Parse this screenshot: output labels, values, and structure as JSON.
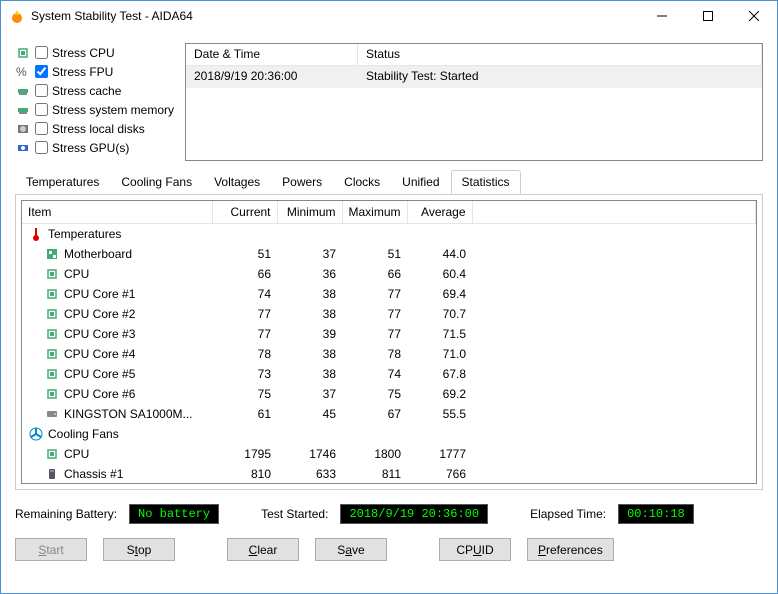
{
  "window": {
    "title": "System Stability Test - AIDA64"
  },
  "stress_options": [
    {
      "label": "Stress CPU",
      "checked": false
    },
    {
      "label": "Stress FPU",
      "checked": true
    },
    {
      "label": "Stress cache",
      "checked": false
    },
    {
      "label": "Stress system memory",
      "checked": false
    },
    {
      "label": "Stress local disks",
      "checked": false
    },
    {
      "label": "Stress GPU(s)",
      "checked": false
    }
  ],
  "log": {
    "headers": {
      "datetime": "Date & Time",
      "status": "Status"
    },
    "rows": [
      {
        "datetime": "2018/9/19 20:36:00",
        "status": "Stability Test: Started"
      }
    ]
  },
  "tabs": [
    "Temperatures",
    "Cooling Fans",
    "Voltages",
    "Powers",
    "Clocks",
    "Unified",
    "Statistics"
  ],
  "active_tab": "Statistics",
  "stats": {
    "headers": {
      "item": "Item",
      "current": "Current",
      "minimum": "Minimum",
      "maximum": "Maximum",
      "average": "Average"
    },
    "groups": [
      {
        "name": "Temperatures",
        "icon": "thermometer",
        "items": [
          {
            "name": "Motherboard",
            "icon": "mobo",
            "current": 51,
            "minimum": 37,
            "maximum": 51,
            "average": "44.0"
          },
          {
            "name": "CPU",
            "icon": "chip",
            "current": 66,
            "minimum": 36,
            "maximum": 66,
            "average": "60.4"
          },
          {
            "name": "CPU Core #1",
            "icon": "chip",
            "current": 74,
            "minimum": 38,
            "maximum": 77,
            "average": "69.4"
          },
          {
            "name": "CPU Core #2",
            "icon": "chip",
            "current": 77,
            "minimum": 38,
            "maximum": 77,
            "average": "70.7"
          },
          {
            "name": "CPU Core #3",
            "icon": "chip",
            "current": 77,
            "minimum": 39,
            "maximum": 77,
            "average": "71.5"
          },
          {
            "name": "CPU Core #4",
            "icon": "chip",
            "current": 78,
            "minimum": 38,
            "maximum": 78,
            "average": "71.0"
          },
          {
            "name": "CPU Core #5",
            "icon": "chip",
            "current": 73,
            "minimum": 38,
            "maximum": 74,
            "average": "67.8"
          },
          {
            "name": "CPU Core #6",
            "icon": "chip",
            "current": 75,
            "minimum": 37,
            "maximum": 75,
            "average": "69.2"
          },
          {
            "name": "KINGSTON SA1000M...",
            "icon": "drive",
            "current": 61,
            "minimum": 45,
            "maximum": 67,
            "average": "55.5"
          }
        ]
      },
      {
        "name": "Cooling Fans",
        "icon": "fan",
        "items": [
          {
            "name": "CPU",
            "icon": "chip",
            "current": 1795,
            "minimum": 1746,
            "maximum": 1800,
            "average": "1777"
          },
          {
            "name": "Chassis #1",
            "icon": "case",
            "current": 810,
            "minimum": 633,
            "maximum": 811,
            "average": "766"
          }
        ]
      }
    ]
  },
  "status_bar": {
    "battery_label": "Remaining Battery:",
    "battery_value": "No battery",
    "started_label": "Test Started:",
    "started_value": "2018/9/19 20:36:00",
    "elapsed_label": "Elapsed Time:",
    "elapsed_value": "00:10:18"
  },
  "buttons": {
    "start": "Start",
    "stop": "Stop",
    "clear": "Clear",
    "save": "Save",
    "cpuid": "CPUID",
    "preferences": "Preferences"
  }
}
